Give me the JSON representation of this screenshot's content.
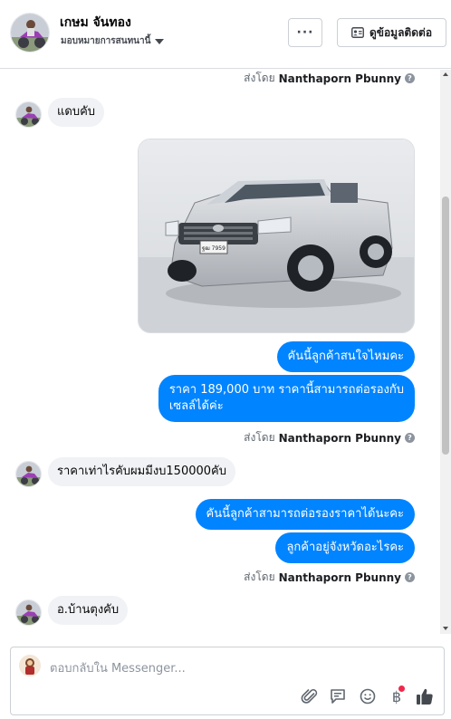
{
  "header": {
    "name": "เกษม จันทอง",
    "subtitle": "มอบหมายการสนทนานี้",
    "more_label": "···",
    "contact_label": "ดูข้อมูลติดต่อ"
  },
  "thread": {
    "sent_by_prefix": "ส่งโดย",
    "sent_by_name": "Nanthaporn Pbunny",
    "messages": [
      {
        "text": "แดบคับ"
      },
      {
        "text": "คันนี้ลูกค้าสนใจไหมคะ"
      },
      {
        "line1": "ราคา 189,000 บาท ราคานี้สามารถต่อรองกับ",
        "line2": "เซลล์ได้ค่ะ"
      },
      {
        "text": "ราคาเท่าไรคับผมมีงบ150000คับ"
      },
      {
        "text": "คันนี้ลูกค้าสามารถต่อรองราคาได้นะคะ"
      },
      {
        "text": "ลูกค้าอยู่จังหวัดอะไรคะ"
      },
      {
        "text": "อ.บ้านตุงคับ"
      }
    ],
    "photo_plate": "ฐฒ 7959"
  },
  "composer": {
    "placeholder": "ตอบกลับใน Messenger...",
    "baht_symbol": "฿"
  },
  "colors": {
    "outgoing_bubble": "#0084ff",
    "incoming_bubble": "#f0f2f5",
    "like_icon": "#444950",
    "notification_dot": "#f02849"
  },
  "icons": [
    "ellipsis-icon",
    "contact-card-icon",
    "question-icon",
    "attach-icon",
    "saved-reply-icon",
    "emoji-icon",
    "baht-icon",
    "thumbs-up-icon"
  ]
}
